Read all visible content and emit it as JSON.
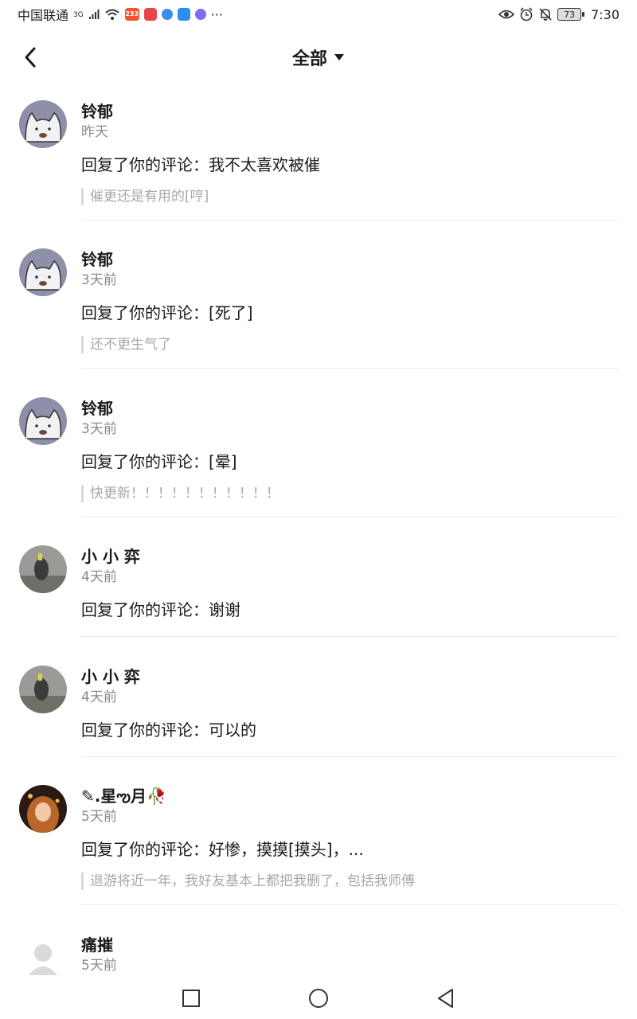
{
  "status_bar": {
    "carrier": "中国联通",
    "network": "3G",
    "app_badge": "233",
    "more": "···",
    "battery": "73",
    "time": "7:30"
  },
  "header": {
    "title": "全部"
  },
  "notifications": [
    {
      "name": "铃郁",
      "time": "昨天",
      "reply": "回复了你的评论：我不太喜欢被催",
      "quote": "催更还是有用的[哼]"
    },
    {
      "name": "铃郁",
      "time": "3天前",
      "reply": "回复了你的评论：[死了]",
      "quote": "还不更生气了"
    },
    {
      "name": "铃郁",
      "time": "3天前",
      "reply": "回复了你的评论：[晕]",
      "quote": "快更新！！！！！！！！！！！"
    },
    {
      "name": "小 小 弈",
      "time": "4天前",
      "reply": "回复了你的评论：谢谢"
    },
    {
      "name": "小 小 弈",
      "time": "4天前",
      "reply": "回复了你的评论：可以的"
    },
    {
      "name": "✎.星ఌ月🥀",
      "time": "5天前",
      "reply": "回复了你的评论：好惨，摸摸[摸头]，...",
      "quote": "退游将近一年，我好友基本上都把我删了，包括我师傅"
    },
    {
      "name": "痛摧",
      "time": "5天前"
    }
  ]
}
